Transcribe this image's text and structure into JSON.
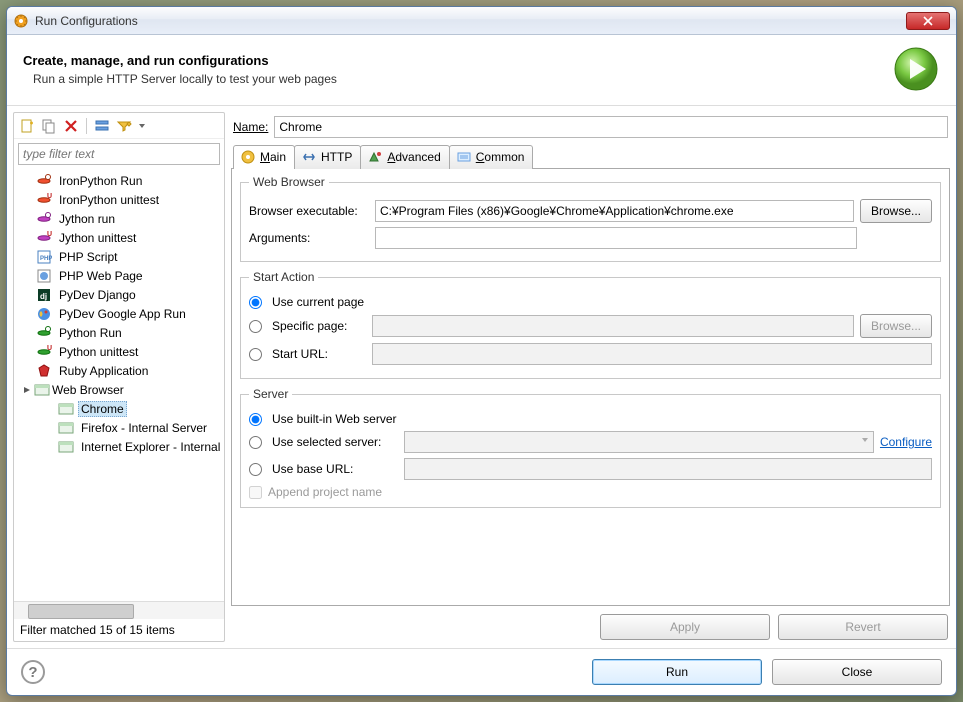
{
  "window": {
    "title": "Run Configurations"
  },
  "header": {
    "title": "Create, manage, and run configurations",
    "subtitle": "Run a simple HTTP Server locally to test your web pages"
  },
  "filter": {
    "placeholder": "type filter text"
  },
  "tree": {
    "items": [
      "IronPython Run",
      "IronPython unittest",
      "Jython run",
      "Jython unittest",
      "PHP Script",
      "PHP Web Page",
      "PyDev Django",
      "PyDev Google App Run",
      "Python Run",
      "Python unittest",
      "Ruby Application"
    ],
    "web_browser": "Web Browser",
    "children": [
      "Chrome",
      "Firefox - Internal Server",
      "Internet Explorer - Internal Server"
    ]
  },
  "left_status": "Filter matched 15 of 15 items",
  "name": {
    "label_pre": "N",
    "label_rest": "ame:",
    "value": "Chrome"
  },
  "tabs": {
    "main": {
      "icon": "main",
      "pre": "M",
      "rest": "ain"
    },
    "http": {
      "label": "HTTP"
    },
    "advanced": {
      "pre": "A",
      "rest": "dvanced"
    },
    "common": {
      "pre": "C",
      "rest": "ommon"
    }
  },
  "web_browser_group": {
    "legend": "Web Browser",
    "exec_label": "Browser executable:",
    "exec_value": "C:¥Program Files (x86)¥Google¥Chrome¥Application¥chrome.exe",
    "browse": "Browse...",
    "args_label": "Arguments:",
    "args_value": ""
  },
  "start_action": {
    "legend": "Start Action",
    "use_current": "Use current page",
    "specific": "Specific page:",
    "browse": "Browse...",
    "start_url": "Start URL:"
  },
  "server": {
    "legend": "Server",
    "builtin": "Use built-in Web server",
    "selected": "Use selected server:",
    "configure": "Configure",
    "base_url": "Use base URL:",
    "append": "Append project name"
  },
  "buttons": {
    "apply": "Apply",
    "revert": "Revert",
    "run": "Run",
    "close": "Close"
  }
}
